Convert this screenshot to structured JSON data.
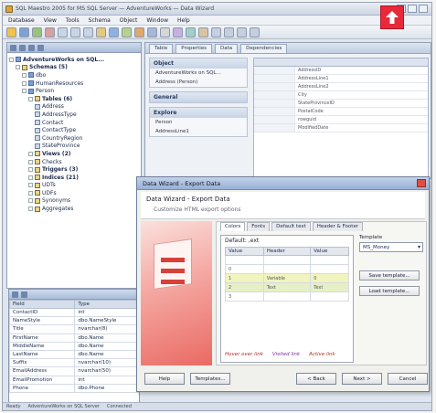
{
  "window": {
    "title": "SQL Maestro 2005 for MS SQL Server — AdventureWorks — Data Wizard"
  },
  "menu": [
    "Database",
    "View",
    "Tools",
    "Schema",
    "Object",
    "Window",
    "Help"
  ],
  "explorer": {
    "tree": [
      {
        "label": "AdventureWorks on SQL...",
        "indent": 0,
        "bold": true,
        "icon": "database-icon"
      },
      {
        "label": "Schemas (5)",
        "indent": 1,
        "bold": true,
        "icon": "folder-icon"
      },
      {
        "label": "dbo",
        "indent": 2,
        "icon": "schema-icon"
      },
      {
        "label": "HumanResources",
        "indent": 2,
        "icon": "schema-icon"
      },
      {
        "label": "Person",
        "indent": 2,
        "icon": "schema-icon"
      },
      {
        "label": "Tables (6)",
        "indent": 3,
        "bold": true,
        "icon": "folder-icon"
      },
      {
        "label": "Address",
        "indent": 4,
        "icon": "table-icon"
      },
      {
        "label": "AddressType",
        "indent": 4,
        "icon": "table-icon"
      },
      {
        "label": "Contact",
        "indent": 4,
        "icon": "table-icon"
      },
      {
        "label": "ContactType",
        "indent": 4,
        "icon": "table-icon"
      },
      {
        "label": "CountryRegion",
        "indent": 4,
        "icon": "table-icon"
      },
      {
        "label": "StateProvince",
        "indent": 4,
        "icon": "table-icon"
      },
      {
        "label": "Views (2)",
        "indent": 3,
        "bold": true,
        "icon": "folder-icon"
      },
      {
        "label": "Checks",
        "indent": 3,
        "icon": "folder-icon"
      },
      {
        "label": "Triggers (3)",
        "indent": 3,
        "bold": true,
        "icon": "folder-icon"
      },
      {
        "label": "Indices (21)",
        "indent": 3,
        "bold": true,
        "icon": "folder-icon"
      },
      {
        "label": "UDTs",
        "indent": 3,
        "icon": "folder-icon"
      },
      {
        "label": "UDFs",
        "indent": 3,
        "icon": "folder-icon"
      },
      {
        "label": "Synonyms",
        "indent": 3,
        "icon": "folder-icon"
      },
      {
        "label": "Aggregates",
        "indent": 3,
        "icon": "folder-icon"
      }
    ]
  },
  "query_window": {
    "tabs": [
      "Table",
      "Properties",
      "Data",
      "Dependencies"
    ],
    "object_group_title": "Object",
    "object_items": [
      "AdventureWorks on SQL...",
      "Address (Person)"
    ],
    "general_title": "General",
    "explore_title": "Explore",
    "explore_items": [
      "Person",
      "AddressLine1"
    ],
    "grid_rows": [
      "AddressID",
      "AddressLine1",
      "AddressLine2",
      "City",
      "StateProvinceID",
      "PostalCode",
      "rowguid",
      "ModifiedDate"
    ]
  },
  "properties": {
    "headers": [
      "Field",
      "Type"
    ],
    "rows": [
      [
        "ContactID",
        "int"
      ],
      [
        "NameStyle",
        "dbo.NameStyle"
      ],
      [
        "Title",
        "nvarchar(8)"
      ],
      [
        "FirstName",
        "dbo.Name"
      ],
      [
        "MiddleName",
        "dbo.Name"
      ],
      [
        "LastName",
        "dbo.Name"
      ],
      [
        "Suffix",
        "nvarchar(10)"
      ],
      [
        "EmailAddress",
        "nvarchar(50)"
      ],
      [
        "EmailPromotion",
        "int"
      ],
      [
        "Phone",
        "dbo.Phone"
      ]
    ]
  },
  "dialog": {
    "title": "Data Wizard - Export Data",
    "header": "Data Wizard - Export Data",
    "subheader": "Customize HTML export options",
    "tabs": [
      "Colors",
      "Fonts",
      "Default text",
      "Header & Footer"
    ],
    "table_label": "Default: ,ext",
    "columns": [
      "Value",
      "Header",
      "Value"
    ],
    "rows": [
      [
        "",
        "",
        ""
      ],
      [
        "0",
        "",
        ""
      ],
      [
        "1",
        "Variable",
        "0"
      ],
      [
        "2",
        "Text",
        "Text"
      ],
      [
        "3",
        "",
        ""
      ]
    ],
    "legend": [
      "Hover over link",
      "Visited link",
      "Active link"
    ],
    "template_label": "Template",
    "template_value": "MS_Money",
    "side_buttons": [
      "Save template...",
      "Load template..."
    ],
    "footer_buttons": [
      "Help",
      "Templates...",
      "< Back",
      "Next >",
      "Cancel"
    ]
  },
  "statusbar": [
    "Ready",
    "AdventureWorks on SQL Server",
    "Connected"
  ],
  "colors": {
    "accent": "#e8293a",
    "titlebar": "#98b0d6"
  }
}
